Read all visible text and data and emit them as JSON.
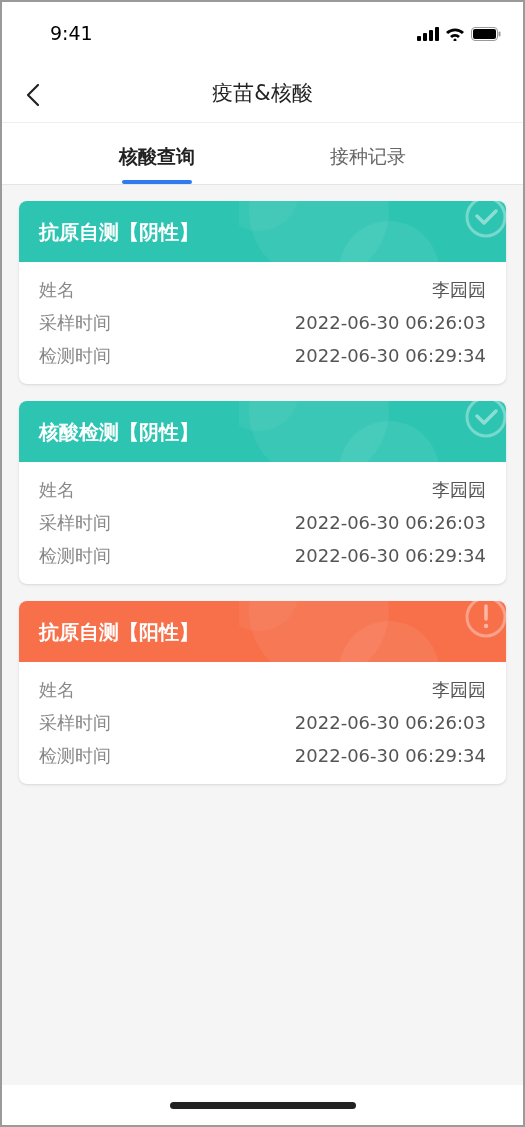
{
  "status_bar": {
    "time": "9:41"
  },
  "nav": {
    "title": "疫苗&核酸"
  },
  "tabs": [
    {
      "label": "核酸查询",
      "selected": true
    },
    {
      "label": "接种记录",
      "selected": false
    }
  ],
  "records": [
    {
      "title": "抗原自测【阴性】",
      "kind": "negative",
      "fields": [
        {
          "label": "姓名",
          "value": "李园园"
        },
        {
          "label": "采样时间",
          "value": "2022-06-30 06:26:03"
        },
        {
          "label": "检测时间",
          "value": "2022-06-30 06:29:34"
        }
      ]
    },
    {
      "title": "核酸检测【阴性】",
      "kind": "negative",
      "fields": [
        {
          "label": "姓名",
          "value": "李园园"
        },
        {
          "label": "采样时间",
          "value": "2022-06-30 06:26:03"
        },
        {
          "label": "检测时间",
          "value": "2022-06-30 06:29:34"
        }
      ]
    },
    {
      "title": "抗原自测【阳性】",
      "kind": "positive",
      "fields": [
        {
          "label": "姓名",
          "value": "李园园"
        },
        {
          "label": "采样时间",
          "value": "2022-06-30 06:26:03"
        },
        {
          "label": "检测时间",
          "value": "2022-06-30 06:29:34"
        }
      ]
    }
  ]
}
